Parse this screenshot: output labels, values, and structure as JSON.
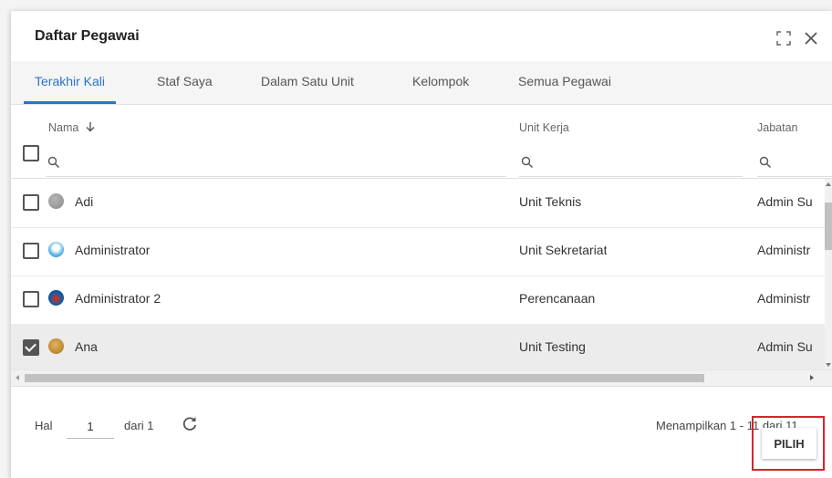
{
  "dialog": {
    "title": "Daftar Pegawai",
    "icons": [
      "fullscreen-icon",
      "close-icon"
    ]
  },
  "tabs": [
    {
      "label": "Terakhir Kali",
      "active": true
    },
    {
      "label": "Staf Saya",
      "active": false
    },
    {
      "label": "Dalam Satu Unit",
      "active": false
    },
    {
      "label": "Kelompok",
      "active": false
    },
    {
      "label": "Semua Pegawai",
      "active": false
    }
  ],
  "columns": {
    "nama": "Nama",
    "sort_icon": "arrow-down-icon",
    "unit": "Unit Kerja",
    "jabatan": "Jabatan"
  },
  "rows": [
    {
      "name": "Adi",
      "unit": "Unit Teknis",
      "jabatan": "Admin Su",
      "checked": false,
      "avatar": "gray-avatar"
    },
    {
      "name": "Administrator",
      "unit": "Unit Sekretariat",
      "jabatan": "Administr",
      "checked": false,
      "avatar": "cartoon-avatar"
    },
    {
      "name": "Administrator 2",
      "unit": "Perencanaan",
      "jabatan": "Administr",
      "checked": false,
      "avatar": "blue-avatar"
    },
    {
      "name": "Ana",
      "unit": "Unit Testing",
      "jabatan": "Admin Su",
      "checked": true,
      "avatar": "photo-avatar"
    }
  ],
  "footer": {
    "hal_label": "Hal",
    "page_value": "1",
    "dari_label": "dari 1",
    "summary": "Menampilkan 1 - 11 dari 11"
  },
  "actions": {
    "pilih_label": "PILIH"
  },
  "colors": {
    "accent": "#2a73c8",
    "highlight_border": "#d9232d",
    "selected_row": "#ececec"
  }
}
